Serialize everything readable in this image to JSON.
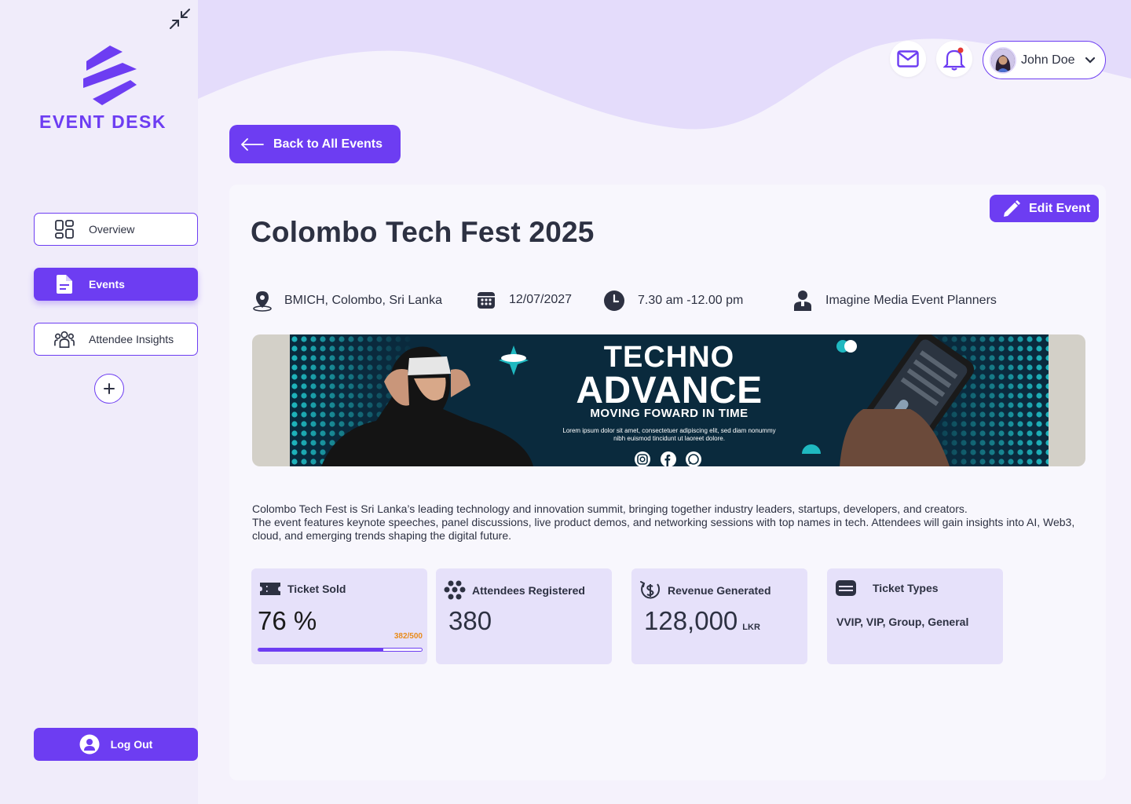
{
  "app": {
    "logo_text": "EVENT DESK",
    "accent_color": "#6d3df2"
  },
  "sidebar": {
    "items": [
      {
        "label": "Overview",
        "icon": "dashboard-icon"
      },
      {
        "label": "Events",
        "icon": "document-icon"
      },
      {
        "label": "Attendee Insights",
        "icon": "people-group-icon"
      }
    ],
    "logout_label": "Log Out"
  },
  "header": {
    "user_name": "John Doe"
  },
  "back_button_label": "Back to All Events",
  "event": {
    "edit_label": "Edit Event",
    "title": "Colombo Tech Fest 2025",
    "location": "BMICH, Colombo, Sri Lanka",
    "date": "12/07/2027",
    "time": "7.30 am -12.00 pm",
    "organizer": "Imagine Media Event Planners",
    "banner": {
      "title_line1": "TECHNO",
      "title_line2": "ADVANCE",
      "subtitle": "MOVING FOWARD IN TIME",
      "lorem": "Lorem ipsum dolor sit amet, consectetuer adipiscing elit, sed diam nonummy nibh euismod tincidunt ut laoreet dolore."
    },
    "description_line1": "Colombo Tech Fest is Sri Lanka’s leading technology and innovation summit, bringing together industry leaders, startups, developers, and creators.",
    "description_line2": "The event features keynote speeches, panel discussions, live product demos, and networking sessions with top names in tech. Attendees will gain insights into AI, Web3, cloud, and emerging trends shaping the digital future."
  },
  "stats": {
    "tickets": {
      "label": "Ticket Sold",
      "value": "76 %",
      "progress_text": "382/500",
      "progress_fraction": 0.764
    },
    "attendees": {
      "label": "Attendees Registered",
      "value": "380"
    },
    "revenue": {
      "label": "Revenue Generated",
      "value": "128,000",
      "unit": "LKR"
    },
    "ticket_types": {
      "label": "Ticket Types",
      "value": "VVIP, VIP, Group, General"
    }
  }
}
